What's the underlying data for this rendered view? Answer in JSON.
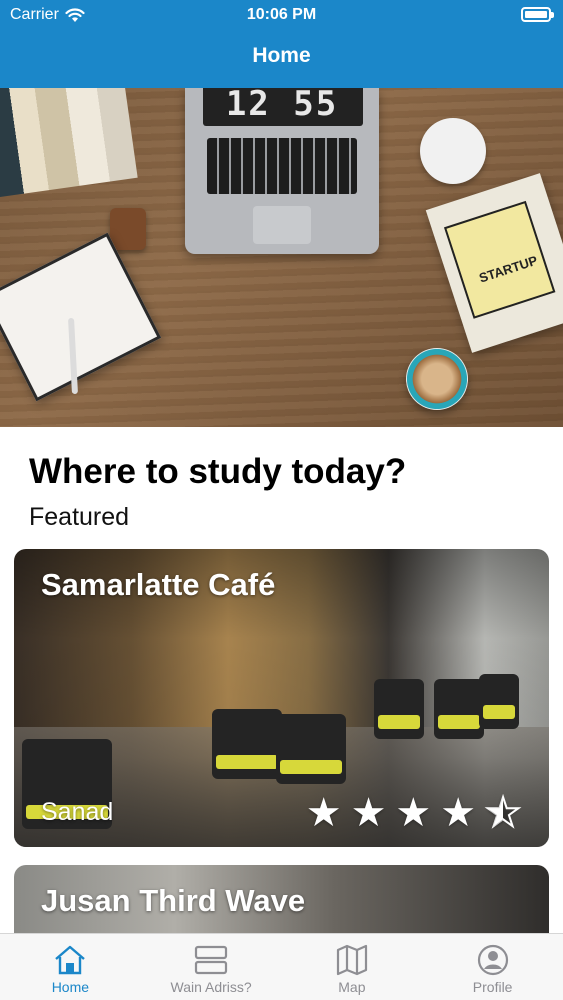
{
  "status_bar": {
    "carrier": "Carrier",
    "time": "10:06 PM",
    "icons": [
      "wifi-icon",
      "battery-icon"
    ]
  },
  "nav": {
    "title": "Home"
  },
  "hero": {
    "laptop_clock": "12 55",
    "book_title": "STARTUP"
  },
  "main": {
    "title": "Where to study today?",
    "subtitle": "Featured",
    "cards": [
      {
        "name": "Samarlatte Café",
        "location": "Sanad",
        "rating": 4.5,
        "max_rating": 5
      },
      {
        "name": "Jusan Third Wave"
      }
    ]
  },
  "tabbar": {
    "active_color": "#1b87c9",
    "inactive_color": "#8e8e93",
    "items": [
      {
        "label": "Home",
        "icon": "home-icon",
        "active": true
      },
      {
        "label": "Wain Adriss?",
        "icon": "list-icon",
        "active": false
      },
      {
        "label": "Map",
        "icon": "map-icon",
        "active": false
      },
      {
        "label": "Profile",
        "icon": "profile-icon",
        "active": false
      }
    ]
  },
  "colors": {
    "header": "#1b87c9",
    "star": "#ffffff"
  }
}
